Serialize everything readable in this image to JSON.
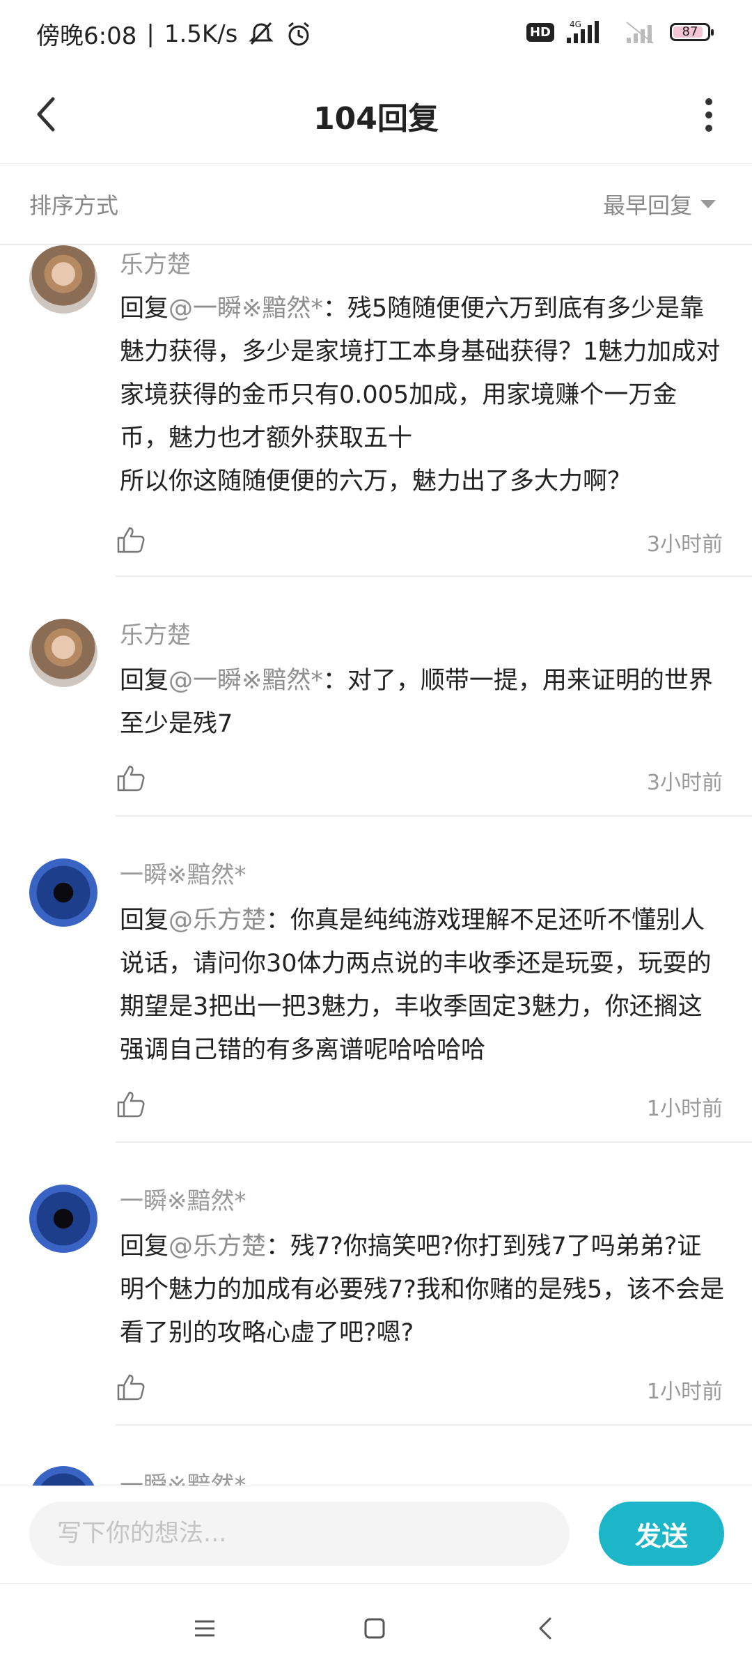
{
  "status_bar": {
    "time": "傍晚6:08",
    "speed": "1.5K/s",
    "hd": "HD",
    "network": "4G",
    "battery": "87"
  },
  "header": {
    "title": "104回复"
  },
  "sort": {
    "label": "排序方式",
    "value": "最早回复"
  },
  "comments": [
    {
      "user": "乐方楚",
      "reply_prefix": "回复",
      "mention": "@一瞬※黯然*",
      "text": "：残5随随便便六万到底有多少是靠魅力获得，多少是家境打工本身基础获得？1魅力加成对家境获得的金币只有0.005加成，用家境赚个一万金币，魅力也才额外获取五十\n所以你这随随便便的六万，魅力出了多大力啊？",
      "time": "3小时前"
    },
    {
      "user": "乐方楚",
      "reply_prefix": "回复",
      "mention": "@一瞬※黯然*",
      "text": "：对了，顺带一提，用来证明的世界至少是残7",
      "time": "3小时前"
    },
    {
      "user": "一瞬※黯然*",
      "reply_prefix": "回复",
      "mention": "@乐方楚",
      "text": "：你真是纯纯游戏理解不足还听不懂别人说话，请问你30体力两点说的丰收季还是玩耍，玩耍的期望是3把出一把3魅力，丰收季固定3魅力，你还搁这强调自己错的有多离谱呢哈哈哈哈",
      "time": "1小时前"
    },
    {
      "user": "一瞬※黯然*",
      "reply_prefix": "回复",
      "mention": "@乐方楚",
      "text": "：残7?你搞笑吧?你打到残7了吗弟弟?证明个魅力的加成有必要残7?我和你赌的是残5，该不会是看了别的攻略心虚了吧?嗯?",
      "time": "1小时前"
    },
    {
      "user": "一瞬※黯然*"
    }
  ],
  "input": {
    "placeholder": "写下你的想法..."
  },
  "send_label": "发送"
}
